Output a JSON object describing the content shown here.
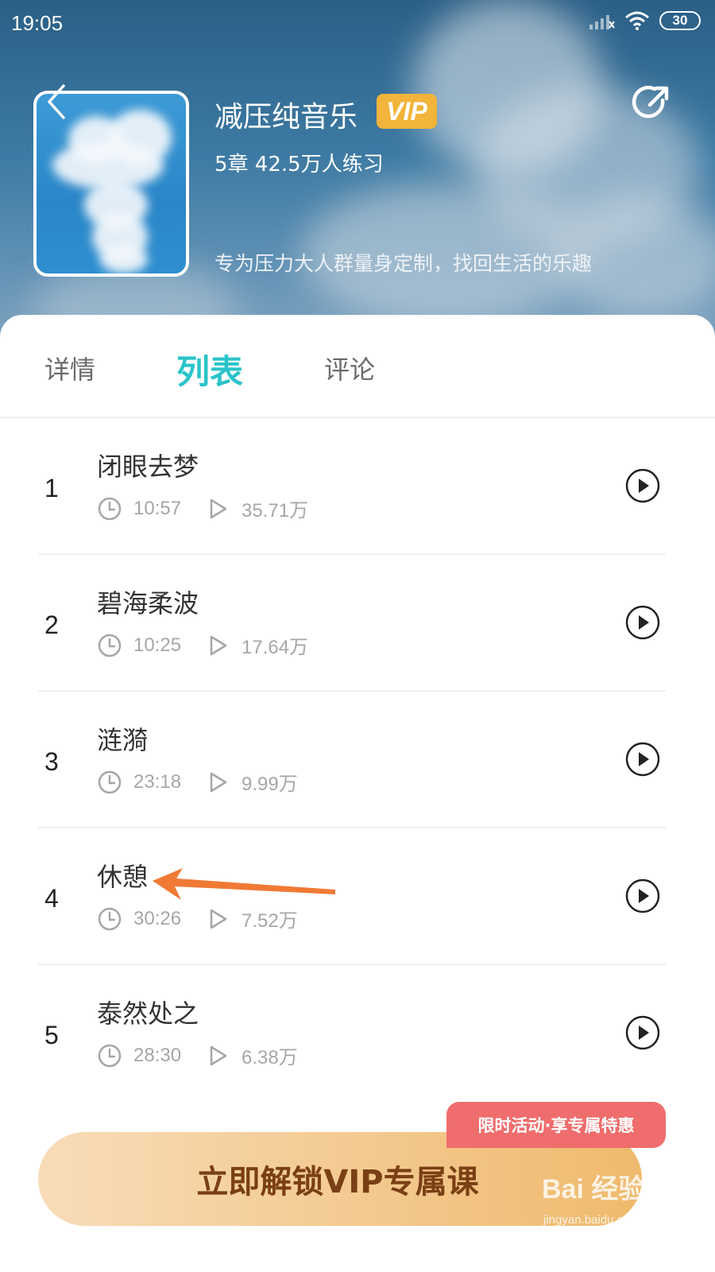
{
  "status_bar": {
    "time": "19:05",
    "battery": "30"
  },
  "course": {
    "title": "减压纯音乐",
    "vip_badge": "VIP",
    "stats": "5章 42.5万人练习",
    "description": "专为压力大人群量身定制，找回生活的乐趣"
  },
  "tabs": [
    {
      "label": "详情",
      "active": false
    },
    {
      "label": "列表",
      "active": true
    },
    {
      "label": "评论",
      "active": false
    }
  ],
  "tracks": [
    {
      "number": "1",
      "title": "闭眼去梦",
      "duration": "10:57",
      "plays": "35.71万"
    },
    {
      "number": "2",
      "title": "碧海柔波",
      "duration": "10:25",
      "plays": "17.64万"
    },
    {
      "number": "3",
      "title": "涟漪",
      "duration": "23:18",
      "plays": "9.99万"
    },
    {
      "number": "4",
      "title": "休憩",
      "duration": "30:26",
      "plays": "7.52万"
    },
    {
      "number": "5",
      "title": "泰然处之",
      "duration": "28:30",
      "plays": "6.38万"
    }
  ],
  "promo": {
    "label": "限时活动·享专属特惠"
  },
  "unlock": {
    "label": "立即解锁VIP专属课"
  },
  "watermark": {
    "brand": "Bai 经验",
    "url": "jingyan.baidu.com"
  },
  "colors": {
    "accent": "#2ac3c9",
    "vip": "#f2b43a",
    "promo": "#ef6d6d",
    "annotation_arrow": "#f07a35",
    "unlock_text": "#7a3f14"
  },
  "icons": [
    "back-icon",
    "share-icon",
    "signal-icon",
    "wifi-icon",
    "battery-icon",
    "clock-icon",
    "play-count-icon",
    "play-button-icon"
  ]
}
